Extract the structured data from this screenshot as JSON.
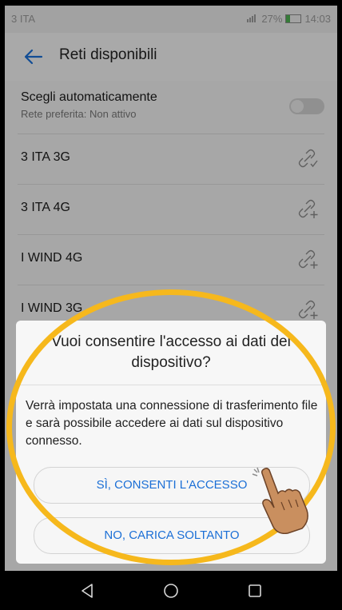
{
  "status_bar": {
    "carrier": "3 ITA",
    "battery_percent": "27%",
    "time": "14:03",
    "battery_level": 0.27
  },
  "header": {
    "title": "Reti disponibili",
    "back_icon": "arrow-left-icon"
  },
  "auto_select": {
    "label": "Scegli automaticamente",
    "subtitle": "Rete preferita: Non attivo",
    "enabled": false
  },
  "networks": [
    {
      "name": "3 ITA 3G",
      "icon": "link-check-icon"
    },
    {
      "name": "3 ITA 4G",
      "icon": "link-add-icon"
    },
    {
      "name": "I WIND 4G",
      "icon": "link-add-icon"
    },
    {
      "name": "I WIND 3G",
      "icon": "link-add-icon"
    }
  ],
  "dialog": {
    "title": "Vuoi consentire l'accesso ai dati del dispositivo?",
    "body": "Verrà impostata una connessione di trasferimento file e sarà possibile accedere ai dati sul dispositivo connesso.",
    "allow_label": "SÌ, CONSENTI L'ACCESSO",
    "charge_only_label": "NO, CARICA SOLTANTO"
  },
  "navigation": {
    "back_icon": "triangle-back-icon",
    "home_icon": "circle-home-icon",
    "recents_icon": "square-recents-icon"
  },
  "colors": {
    "accent": "#1b6fd6",
    "highlight": "#f6b81c"
  }
}
